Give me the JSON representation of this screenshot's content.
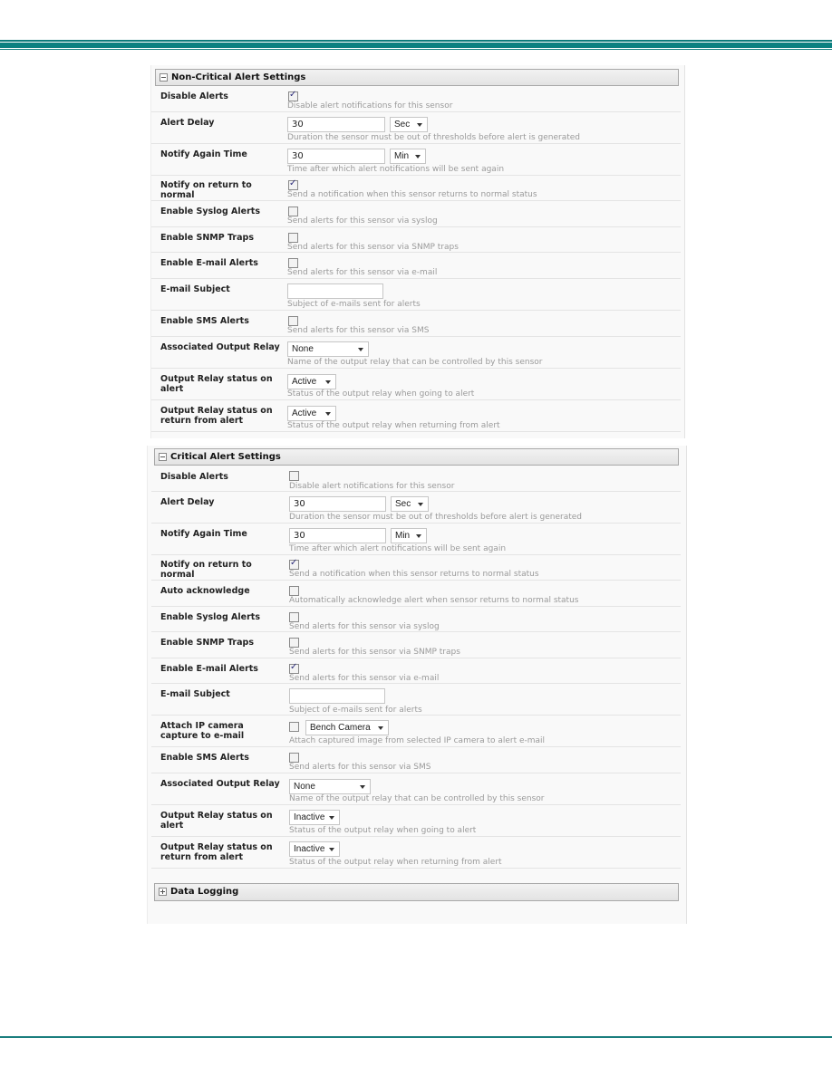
{
  "noncritical": {
    "title": "Non-Critical Alert Settings",
    "rows": [
      {
        "label": "Disable Alerts",
        "help": "Disable alert notifications for this sensor",
        "checked": true
      },
      {
        "label": "Alert Delay",
        "value": "30",
        "unit": "Sec",
        "help": "Duration the sensor must be out of thresholds before alert is generated"
      },
      {
        "label": "Notify Again Time",
        "value": "30",
        "unit": "Min",
        "help": "Time after which alert notifications will be sent again"
      },
      {
        "label": "Notify on return to normal",
        "help": "Send a notification when this sensor returns to normal status",
        "checked": true
      },
      {
        "label": "Enable Syslog Alerts",
        "help": "Send alerts for this sensor via syslog",
        "checked": false
      },
      {
        "label": "Enable SNMP Traps",
        "help": "Send alerts for this sensor via SNMP traps",
        "checked": false
      },
      {
        "label": "Enable E-mail Alerts",
        "help": "Send alerts for this sensor via e-mail",
        "checked": false
      },
      {
        "label": "E-mail Subject",
        "value": "",
        "help": "Subject of e-mails sent for alerts"
      },
      {
        "label": "Enable SMS Alerts",
        "help": "Send alerts for this sensor via SMS",
        "checked": false
      },
      {
        "label": "Associated Output Relay",
        "value": "None",
        "help": "Name of the output relay that can be controlled by this sensor"
      },
      {
        "label": "Output Relay status on alert",
        "value": "Active",
        "help": "Status of the output relay when going to alert"
      },
      {
        "label": "Output Relay status on return from alert",
        "value": "Active",
        "help": "Status of the output relay when returning from alert"
      }
    ]
  },
  "critical": {
    "title": "Critical Alert Settings",
    "rows": [
      {
        "label": "Disable Alerts",
        "help": "Disable alert notifications for this sensor",
        "checked": false
      },
      {
        "label": "Alert Delay",
        "value": "30",
        "unit": "Sec",
        "help": "Duration the sensor must be out of thresholds before alert is generated"
      },
      {
        "label": "Notify Again Time",
        "value": "30",
        "unit": "Min",
        "help": "Time after which alert notifications will be sent again"
      },
      {
        "label": "Notify on return to normal",
        "help": "Send a notification when this sensor returns to normal status",
        "checked": true
      },
      {
        "label": "Auto acknowledge",
        "help": "Automatically acknowledge alert when sensor returns to normal status",
        "checked": false
      },
      {
        "label": "Enable Syslog Alerts",
        "help": "Send alerts for this sensor via syslog",
        "checked": false
      },
      {
        "label": "Enable SNMP Traps",
        "help": "Send alerts for this sensor via SNMP traps",
        "checked": false
      },
      {
        "label": "Enable E-mail Alerts",
        "help": "Send alerts for this sensor via e-mail",
        "checked": true
      },
      {
        "label": "E-mail Subject",
        "value": "",
        "help": "Subject of e-mails sent for alerts"
      },
      {
        "label": "Attach IP camera capture to e-mail",
        "value": "Bench Camera",
        "help": "Attach captured image from selected IP camera to alert e-mail",
        "checked": false
      },
      {
        "label": "Enable SMS Alerts",
        "help": "Send alerts for this sensor via SMS",
        "checked": false
      },
      {
        "label": "Associated Output Relay",
        "value": "None",
        "help": "Name of the output relay that can be controlled by this sensor"
      },
      {
        "label": "Output Relay status on alert",
        "value": "Inactive",
        "help": "Status of the output relay when going to alert"
      },
      {
        "label": "Output Relay status on return from alert",
        "value": "Inactive",
        "help": "Status of the output relay when returning from alert"
      }
    ]
  },
  "data_logging": {
    "title": "Data Logging"
  },
  "colors": {
    "accent_rule": "#0b8080"
  }
}
